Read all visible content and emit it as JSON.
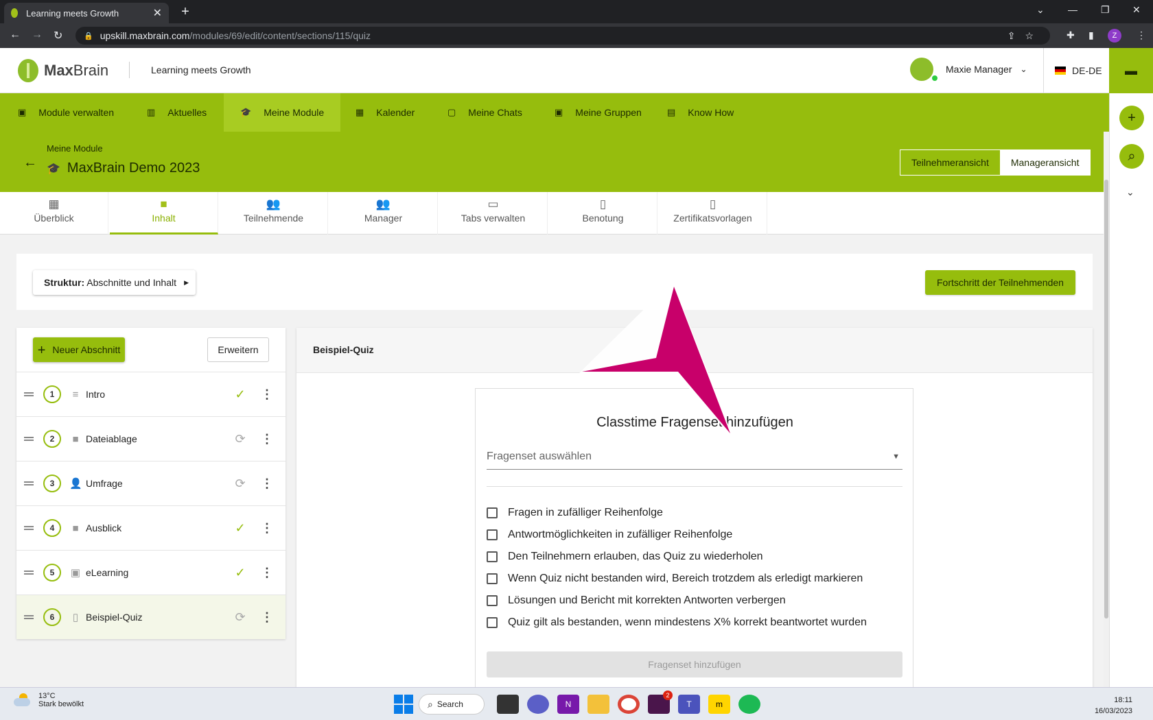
{
  "browser": {
    "tab_title": "Learning meets Growth",
    "url_host": "upskill.maxbrain.com",
    "url_path": "/modules/69/edit/content/sections/115/quiz",
    "profile_initial": "Z"
  },
  "header": {
    "logo_text_bold": "Max",
    "logo_text": "Brain",
    "tagline": "Learning meets Growth",
    "user_name": "Maxie Manager",
    "language": "DE-DE"
  },
  "menu": [
    {
      "label": "Module verwalten",
      "icon": "folder-icon"
    },
    {
      "label": "Aktuelles",
      "icon": "news-icon"
    },
    {
      "label": "Meine Module",
      "icon": "graduation-cap-icon"
    },
    {
      "label": "Kalender",
      "icon": "calendar-icon"
    },
    {
      "label": "Meine Chats",
      "icon": "chat-icon"
    },
    {
      "label": "Meine Gruppen",
      "icon": "group-icon"
    },
    {
      "label": "Know How",
      "icon": "book-icon"
    }
  ],
  "module": {
    "breadcrumb": "Meine Module",
    "title": "MaxBrain Demo 2023",
    "view_participant": "Teilnehmeransicht",
    "view_manager": "Manageransicht"
  },
  "subtabs": [
    {
      "label": "Überblick",
      "icon": "dashboard-icon"
    },
    {
      "label": "Inhalt",
      "icon": "folder-icon"
    },
    {
      "label": "Teilnehmende",
      "icon": "people-icon"
    },
    {
      "label": "Manager",
      "icon": "manager-icon"
    },
    {
      "label": "Tabs verwalten",
      "icon": "window-icon"
    },
    {
      "label": "Benotung",
      "icon": "grade-icon"
    },
    {
      "label": "Zertifikatsvorlagen",
      "icon": "certificate-icon"
    }
  ],
  "structure": {
    "label_bold": "Struktur:",
    "label": "Abschnitte und Inhalt",
    "progress_button": "Fortschritt der Teilnehmenden"
  },
  "sections": {
    "new_button": "Neuer Abschnitt",
    "expand_button": "Erweitern",
    "items": [
      {
        "num": "1",
        "label": "Intro",
        "status": "done"
      },
      {
        "num": "2",
        "label": "Dateiablage",
        "status": "sync"
      },
      {
        "num": "3",
        "label": "Umfrage",
        "status": "sync"
      },
      {
        "num": "4",
        "label": "Ausblick",
        "status": "done"
      },
      {
        "num": "5",
        "label": "eLearning",
        "status": "done"
      },
      {
        "num": "6",
        "label": "Beispiel-Quiz",
        "status": "sync"
      }
    ]
  },
  "quiz": {
    "panel_title": "Beispiel-Quiz",
    "card_title": "Classtime Fragenset hinzufügen",
    "select_placeholder": "Fragenset auswählen",
    "options": [
      "Fragen in zufälliger Reihenfolge",
      "Antwortmöglichkeiten in zufälliger Reihenfolge",
      "Den Teilnehmern erlauben, das Quiz zu wiederholen",
      "Wenn Quiz nicht bestanden wird, Bereich trotzdem als erledigt markieren",
      "Lösungen und Bericht mit korrekten Antworten verbergen",
      "Quiz gilt als bestanden, wenn mindestens X% korrekt beantwortet wurden"
    ],
    "add_button": "Fragenset hinzufügen"
  },
  "taskbar": {
    "temp": "13°C",
    "weather": "Stark bewölkt",
    "search": "Search",
    "time": "18:11",
    "date": "16/03/2023",
    "slack_badge": "2"
  },
  "colors": {
    "accent": "#96bd0d",
    "arrow": "#c8006a"
  }
}
